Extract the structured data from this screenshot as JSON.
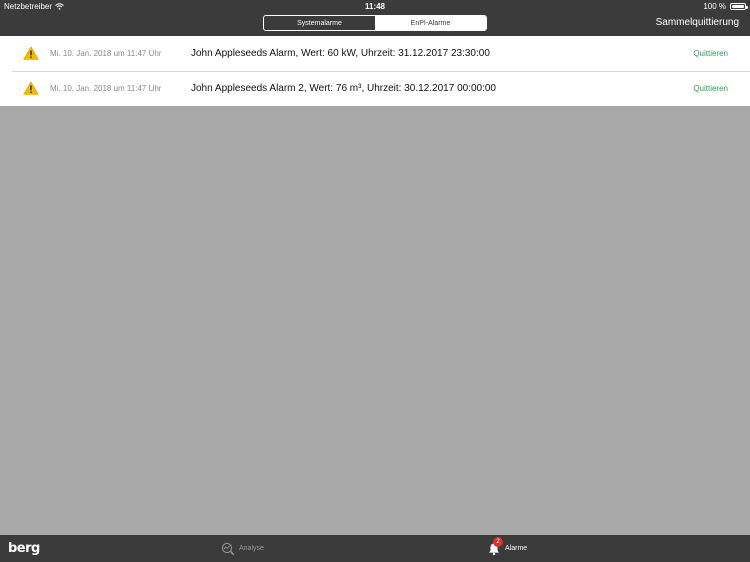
{
  "status_bar": {
    "carrier": "Netzbetreiber",
    "time": "11:48",
    "battery": "100 %",
    "battery_level": 1.0
  },
  "header": {
    "tabs": [
      {
        "label": "Systemalarme",
        "selected": false
      },
      {
        "label": "EnPI-Alarme",
        "selected": true
      }
    ],
    "collect_ack_label": "Sammelquittierung"
  },
  "alarms": [
    {
      "date": "Mi. 10. Jan. 2018 um 11:47 Uhr",
      "message": "John Appleseeds Alarm, Wert: 60 kW, Uhrzeit: 31.12.2017 23:30:00",
      "action": "Quittieren"
    },
    {
      "date": "Mi. 10. Jan. 2018 um 11:47 Uhr",
      "message": "John Appleseeds Alarm 2, Wert: 76 m³, Uhrzeit: 30.12.2017 00:00:00",
      "action": "Quittieren"
    }
  ],
  "tabbar": {
    "logo": "berg",
    "analyse_label": "Analyse",
    "alarme_label": "Alarme",
    "alarm_badge": "2"
  },
  "colors": {
    "bar_bg": "#3b3b3b",
    "accent_green": "#2e9d5a",
    "warning_yellow": "#f5b800",
    "badge_red": "#d9302d",
    "empty_bg": "#a8a8a8"
  },
  "icons": {
    "signal": "wifi-icon",
    "warning": "warning-triangle-icon",
    "analyse": "analyse-icon",
    "alarm": "bell-icon"
  }
}
